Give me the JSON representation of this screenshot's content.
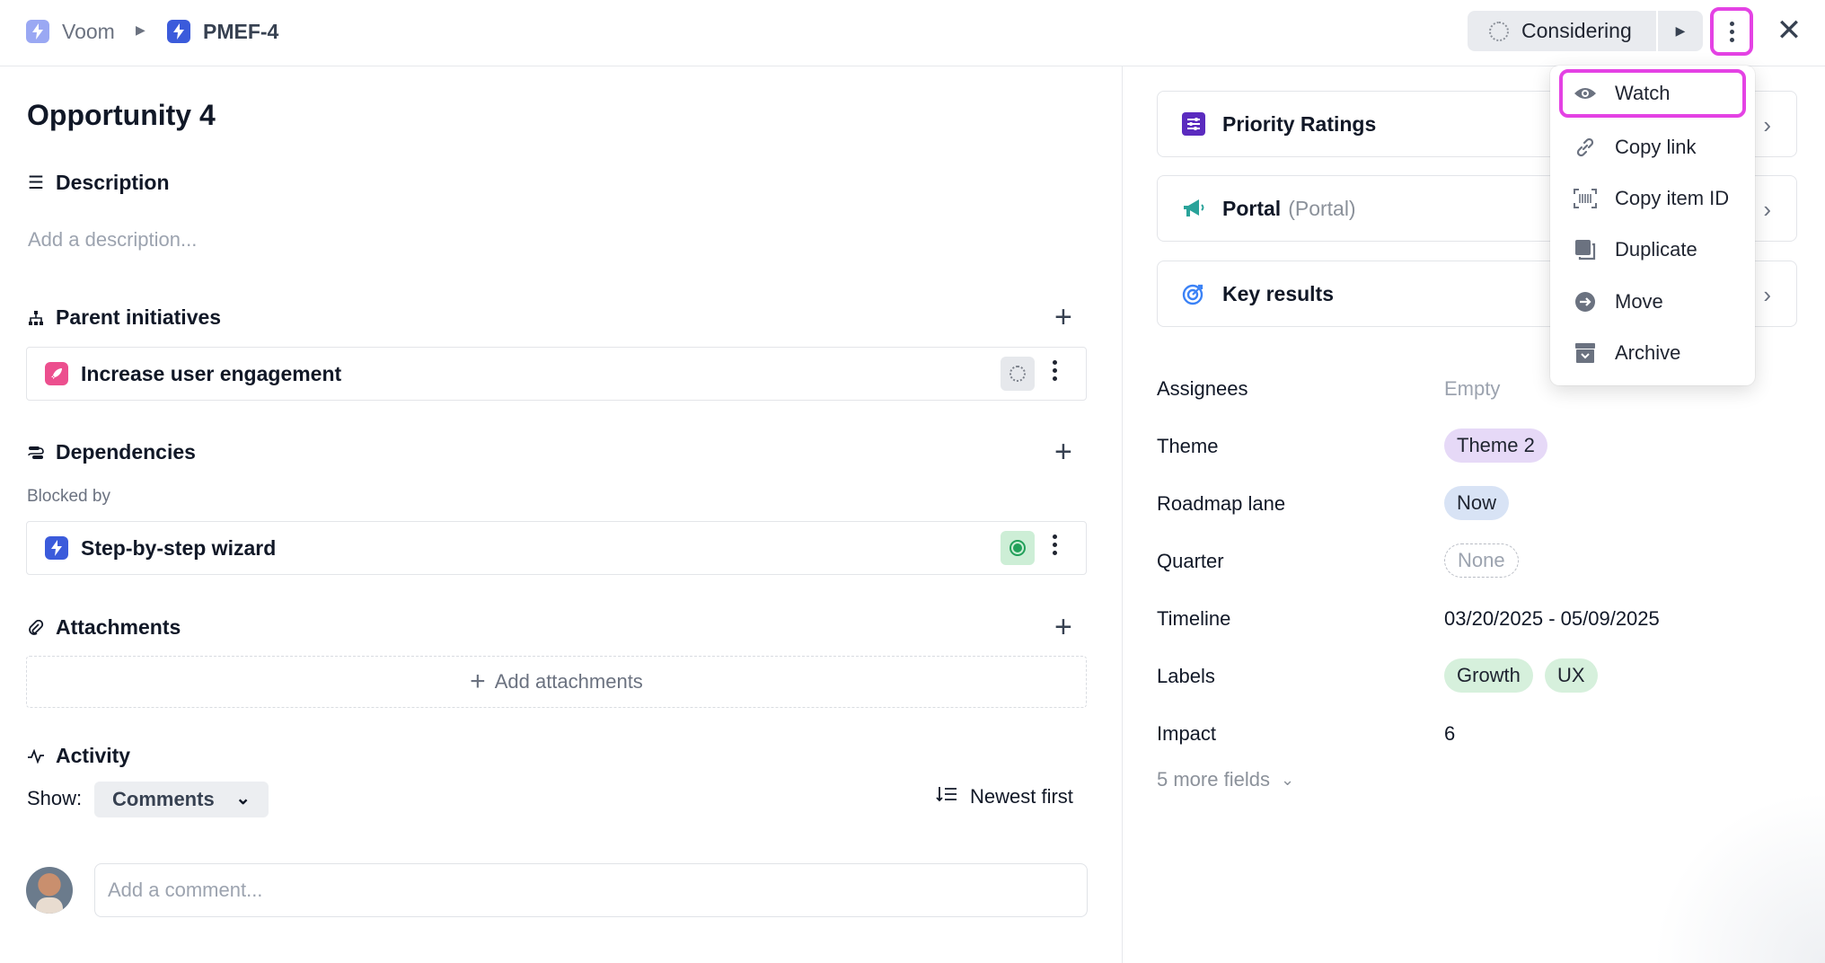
{
  "breadcrumb": {
    "workspace": "Voom",
    "item_id": "PMEF-4"
  },
  "header": {
    "status": "Considering"
  },
  "item": {
    "title": "Opportunity 4",
    "description_heading": "Description",
    "description_placeholder": "Add a description...",
    "parent_initiatives_heading": "Parent initiatives",
    "parent_initiative": "Increase user engagement",
    "dependencies_heading": "Dependencies",
    "blocked_by_label": "Blocked by",
    "dependency": "Step-by-step wizard",
    "attachments_heading": "Attachments",
    "add_attachments": "Add attachments",
    "activity_heading": "Activity",
    "show_label": "Show:",
    "show_value": "Comments",
    "sort_label": "Newest first",
    "comment_placeholder": "Add a comment..."
  },
  "sidebar": {
    "cards": [
      {
        "label": "Priority Ratings"
      },
      {
        "label": "Portal",
        "sub": "(Portal)"
      },
      {
        "label": "Key results"
      }
    ],
    "fields": {
      "assignees_label": "Assignees",
      "assignees_value": "Empty",
      "theme_label": "Theme",
      "theme_value": "Theme 2",
      "roadmap_label": "Roadmap lane",
      "roadmap_value": "Now",
      "quarter_label": "Quarter",
      "quarter_value": "None",
      "timeline_label": "Timeline",
      "timeline_value": "03/20/2025 - 05/09/2025",
      "labels_label": "Labels",
      "labels_values": [
        "Growth",
        "UX"
      ],
      "impact_label": "Impact",
      "impact_value": "6"
    },
    "more_fields": "5 more fields"
  },
  "menu": {
    "items": [
      {
        "label": "Watch",
        "icon": "eye-icon"
      },
      {
        "label": "Copy link",
        "icon": "link-icon"
      },
      {
        "label": "Copy item ID",
        "icon": "barcode-icon"
      },
      {
        "label": "Duplicate",
        "icon": "duplicate-icon"
      },
      {
        "label": "Move",
        "icon": "arrow-right-circle-icon"
      },
      {
        "label": "Archive",
        "icon": "archive-icon"
      }
    ]
  },
  "colors": {
    "highlight": "#e442e4",
    "accent": "#3b5bdb",
    "status_green": "#22a05a"
  }
}
